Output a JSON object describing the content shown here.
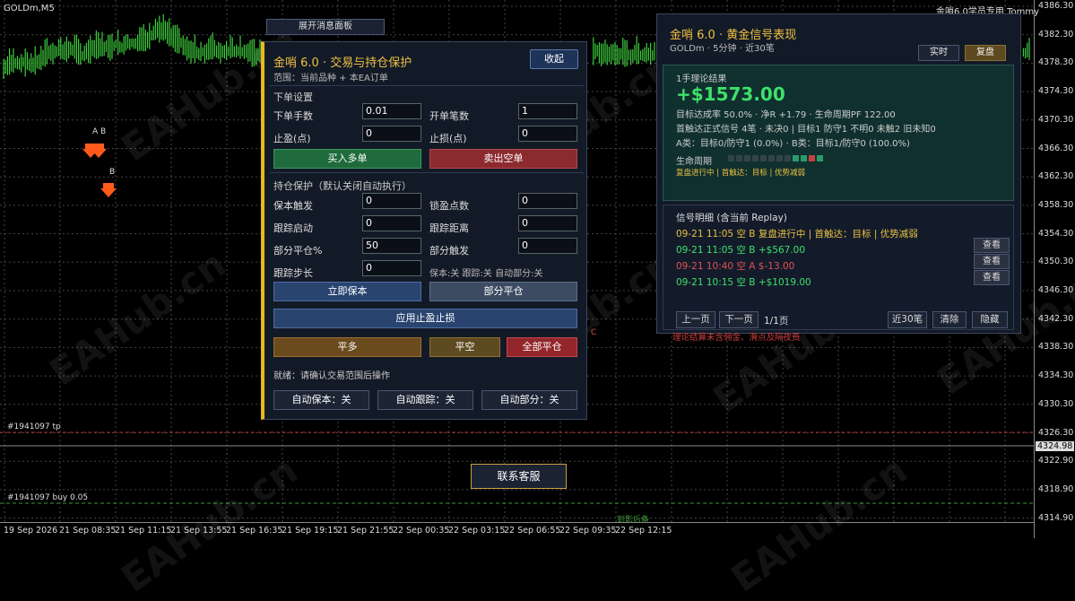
{
  "chart": {
    "symbol": "GOLDm,M5",
    "account": "金哨6.0学员专用 Tommy",
    "price_ticks": [
      "4386.30",
      "4382.30",
      "4378.30",
      "4374.30",
      "4370.30",
      "4366.30",
      "4362.30",
      "4358.30",
      "4354.30",
      "4350.30",
      "4346.30",
      "4342.30",
      "4338.30",
      "4334.30",
      "4330.30",
      "4326.30",
      "4322.90",
      "4318.90",
      "4314.90"
    ],
    "current_price": "4324.98",
    "time_ticks": [
      "19 Sep 2026",
      "21 Sep 08:35",
      "21 Sep 11:15",
      "21 Sep 13:55",
      "21 Sep 16:35",
      "21 Sep 19:15",
      "21 Sep 21:55",
      "22 Sep 00:35",
      "22 Sep 03:15",
      "22 Sep 06:55",
      "22 Sep 09:35",
      "22 Sep 12:15"
    ],
    "tp_label": "#1941097 tp",
    "buy_label": "#1941097 buy 0.05",
    "marker_ab": "A B",
    "marker_b": "B",
    "marker_c": "C",
    "bottom_note": "到影后备",
    "watermark": "EAHub.cn",
    "colors": {
      "candle": "#3ecf3e",
      "arrow": "#ff5a1a",
      "tp_line": "#b03030",
      "buy_line": "#3a9a3a"
    }
  },
  "expand_button": "展开消息面板",
  "trade": {
    "title": "金哨 6.0 · 交易与持仓保护",
    "scope": "范围：当前品种 + 本EA订单",
    "collapse": "收起",
    "order_section": "下单设置",
    "lot_label": "下单手数",
    "lot_value": "0.01",
    "count_label": "开单笔数",
    "count_value": "1",
    "tp_label": "止盈(点)",
    "tp_value": "0",
    "sl_label": "止损(点)",
    "sl_value": "0",
    "buy": "买入多单",
    "sell": "卖出空单",
    "protect_section": "持仓保护（默认关闭自动执行）",
    "be_trigger_label": "保本触发",
    "be_trigger_value": "0",
    "lock_label": "锁盈点数",
    "lock_value": "0",
    "trail_start_label": "跟踪启动",
    "trail_start_value": "0",
    "trail_dist_label": "跟踪距离",
    "trail_dist_value": "0",
    "partial_pct_label": "部分平仓%",
    "partial_pct_value": "50",
    "partial_trig_label": "部分触发",
    "partial_trig_value": "0",
    "trail_step_label": "跟踪步长",
    "trail_step_value": "0",
    "status_inline": "保本:关 跟踪:关 自动部分:关",
    "breakeven_now": "立即保本",
    "partial_close": "部分平仓",
    "apply_tpsl": "应用止盈止损",
    "close_long": "平多",
    "close_short": "平空",
    "close_all": "全部平仓",
    "ready": "就绪：请确认交易范围后操作",
    "auto_be": "自动保本：关",
    "auto_trail": "自动跟踪：关",
    "auto_partial": "自动部分：关"
  },
  "signal": {
    "title": "金哨 6.0 · 黄金信号表现",
    "sub": "GOLDm · 5分钟 · 近30笔",
    "tab_live": "实时",
    "tab_replay": "复盘",
    "result_title": "1手理论结果",
    "amount": "+$1573.00",
    "line1": "目标达成率 50.0% · 净R +1.79 · 生命周期PF 122.00",
    "line2": "首触达正式信号 4笔 · 未决0 | 目标1 防守1 不明0 未触2 旧未知0",
    "line3": "A类：目标0/防守1 (0.0%) · B类：目标1/防守0 (100.0%)",
    "lifecycle_label": "生命周期",
    "tags": "复盘进行中 | 首触达：目标 | 优势减弱",
    "heatmap": [
      "#33424a",
      "#33424a",
      "#33424a",
      "#33424a",
      "#33424a",
      "#33424a",
      "#33424a",
      "#33424a",
      "#2a9a6a",
      "#2a9a6a",
      "#c84040",
      "#2a9a6a"
    ],
    "detail_title": "信号明细 (含当前 Replay)",
    "rows": [
      {
        "text": "09-21 11:05 空 B 复盘进行中 | 首触达：目标 | 优势减弱",
        "color": "#e8c040"
      },
      {
        "text": "09-21 11:05 空 B +$567.00",
        "color": "#3ee06a"
      },
      {
        "text": "09-21 10:40 空 A $-13.00",
        "color": "#e05050"
      },
      {
        "text": "09-21 10:15 空 B +$1019.00",
        "color": "#3ee06a"
      }
    ],
    "view": "查看",
    "prev": "上一页",
    "next": "下一页",
    "page": "1/1页",
    "recent": "近30笔",
    "clear": "清除",
    "hide": "隐藏"
  },
  "disclaimer": "理论结算未含佣金、滑点及隔夜费",
  "contact": "联系客服"
}
